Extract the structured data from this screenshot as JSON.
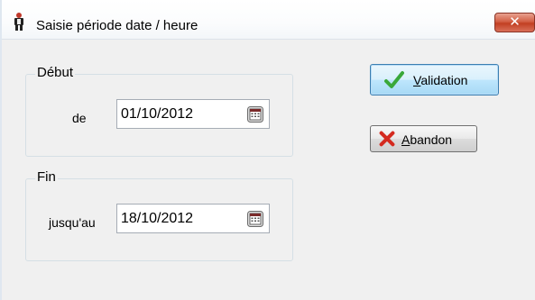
{
  "window": {
    "title": "Saisie période date / heure",
    "icon": "app-person-icon",
    "close_glyph": "✕"
  },
  "debut": {
    "legend": "Début",
    "field_label": "de",
    "date_value": "01/10/2012",
    "icon": "calendar-icon"
  },
  "fin": {
    "legend": "Fin",
    "field_label": "jusqu'au",
    "date_value": "18/10/2012",
    "icon": "calendar-icon"
  },
  "buttons": {
    "validation": {
      "mnemonic": "V",
      "rest": "alidation",
      "icon": "checkmark-icon"
    },
    "abandon": {
      "mnemonic": "A",
      "rest": "bandon",
      "icon": "cross-icon"
    }
  },
  "colors": {
    "check_green": "#3aa83a",
    "cross_red": "#d42a1f",
    "window_bg": "#f0f0f0",
    "close_red": "#c94a2f"
  }
}
